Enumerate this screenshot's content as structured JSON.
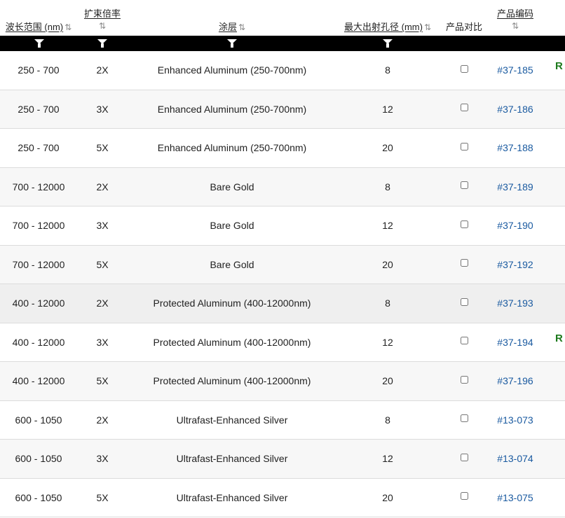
{
  "header": {
    "wavelength": "波长范围 (nm)",
    "expansion": "扩束倍率",
    "coating": "涂层",
    "aperture": "最大出射孔径 (mm)",
    "compare": "产品对比",
    "part_number": "产品编码",
    "sort_icon": "⇅"
  },
  "rows": [
    {
      "wavelength": "250 - 700",
      "expansion": "2X",
      "coating": "Enhanced Aluminum (250-700nm)",
      "aperture": "8",
      "part": "#37-185",
      "extra": "R"
    },
    {
      "wavelength": "250 - 700",
      "expansion": "3X",
      "coating": "Enhanced Aluminum (250-700nm)",
      "aperture": "12",
      "part": "#37-186",
      "extra": ""
    },
    {
      "wavelength": "250 - 700",
      "expansion": "5X",
      "coating": "Enhanced Aluminum (250-700nm)",
      "aperture": "20",
      "part": "#37-188",
      "extra": ""
    },
    {
      "wavelength": "700 - 12000",
      "expansion": "2X",
      "coating": "Bare Gold",
      "aperture": "8",
      "part": "#37-189",
      "extra": ""
    },
    {
      "wavelength": "700 - 12000",
      "expansion": "3X",
      "coating": "Bare Gold",
      "aperture": "12",
      "part": "#37-190",
      "extra": ""
    },
    {
      "wavelength": "700 - 12000",
      "expansion": "5X",
      "coating": "Bare Gold",
      "aperture": "20",
      "part": "#37-192",
      "extra": ""
    },
    {
      "wavelength": "400 - 12000",
      "expansion": "2X",
      "coating": "Protected Aluminum (400-12000nm)",
      "aperture": "8",
      "part": "#37-193",
      "extra": ""
    },
    {
      "wavelength": "400 - 12000",
      "expansion": "3X",
      "coating": "Protected Aluminum (400-12000nm)",
      "aperture": "12",
      "part": "#37-194",
      "extra": "R"
    },
    {
      "wavelength": "400 - 12000",
      "expansion": "5X",
      "coating": "Protected Aluminum (400-12000nm)",
      "aperture": "20",
      "part": "#37-196",
      "extra": ""
    },
    {
      "wavelength": "600 - 1050",
      "expansion": "2X",
      "coating": "Ultrafast-Enhanced Silver",
      "aperture": "8",
      "part": "#13-073",
      "extra": ""
    },
    {
      "wavelength": "600 - 1050",
      "expansion": "3X",
      "coating": "Ultrafast-Enhanced Silver",
      "aperture": "12",
      "part": "#13-074",
      "extra": ""
    },
    {
      "wavelength": "600 - 1050",
      "expansion": "5X",
      "coating": "Ultrafast-Enhanced Silver",
      "aperture": "20",
      "part": "#13-075",
      "extra": ""
    }
  ],
  "colors": {
    "link": "#1a5aa0",
    "filter_bar": "#000000",
    "extra_text": "#1d7a1d"
  }
}
